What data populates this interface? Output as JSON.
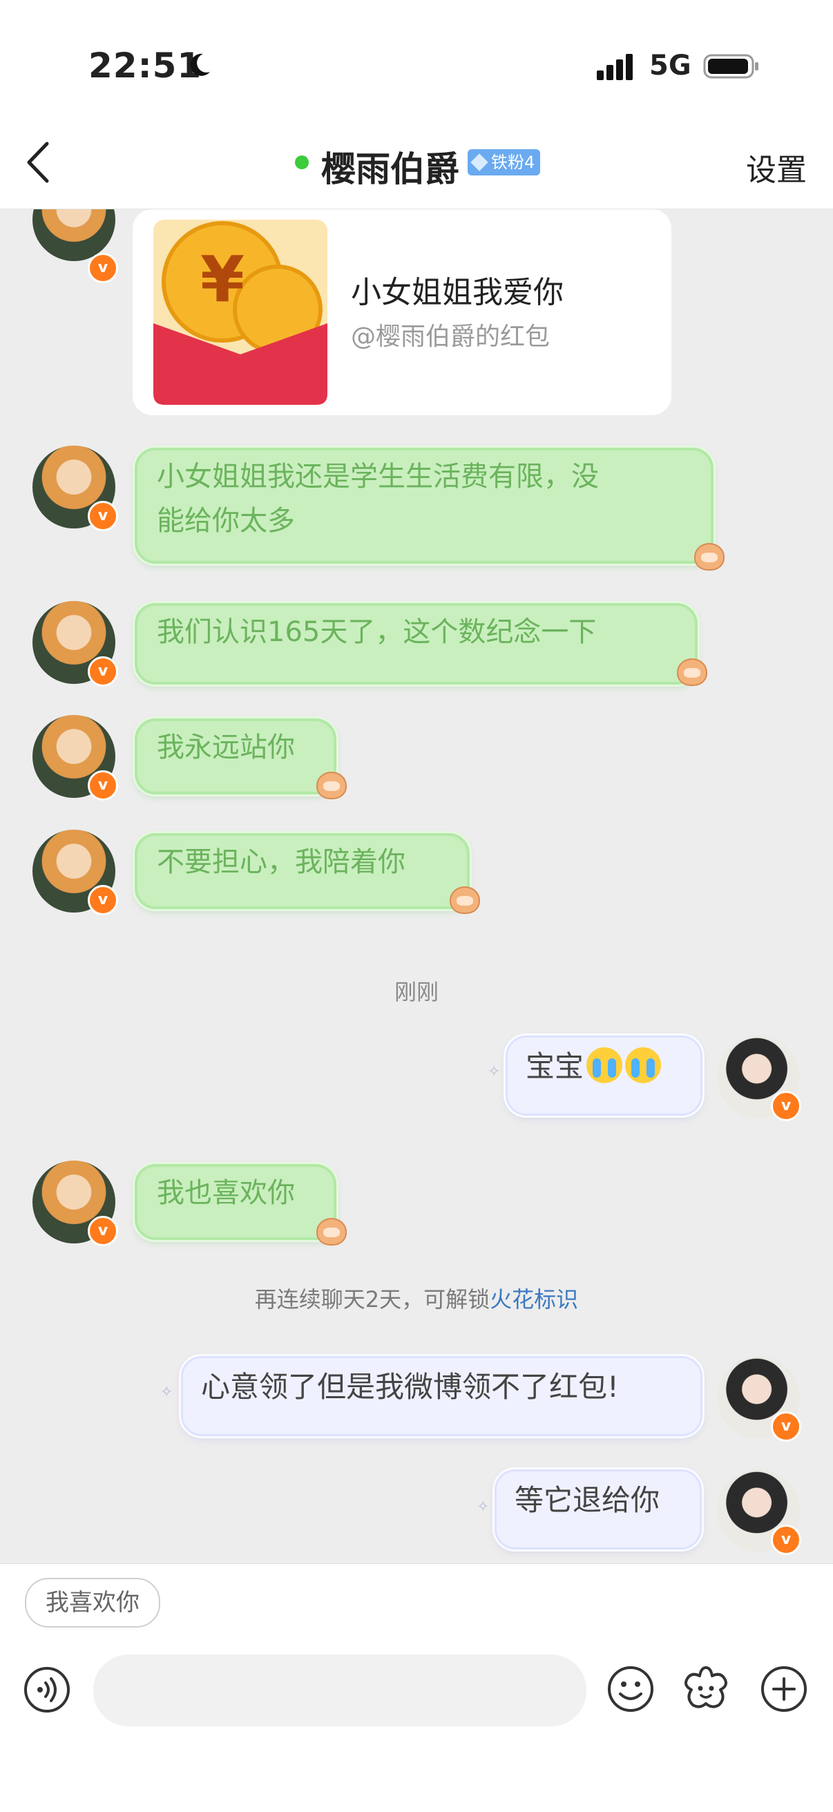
{
  "status_bar": {
    "time": "22:51",
    "network": "5G"
  },
  "header": {
    "title": "樱雨伯爵",
    "badge": "铁粉4",
    "settings": "设置"
  },
  "messages": {
    "red_packet": {
      "title": "小女姐姐我爱你",
      "subtitle": "@樱雨伯爵的红包"
    },
    "m1_line1": "小女姐姐我还是学生生活费有限，没",
    "m1_line2": "能给你太多",
    "m2": "我们认识165天了，这个数纪念一下",
    "m3": "我永远站你",
    "m4": "不要担心，我陪着你",
    "timestamp": "刚刚",
    "me1": "宝宝",
    "m5": "我也喜欢你",
    "hint_prefix": "再连续聊天2天，可解锁",
    "hint_link": "火花标识",
    "me2": "心意领了但是我微博领不了红包!",
    "me3": "等它退给你"
  },
  "input_area": {
    "quick_reply": "我喜欢你",
    "input_placeholder": ""
  },
  "icons": {
    "back": "chevron-left-icon",
    "voice": "voice-icon",
    "emoji": "emoji-icon",
    "sticker": "sticker-icon",
    "add": "plus-icon",
    "verified": "v"
  },
  "colors": {
    "accent_green": "#3ccc3c",
    "bubble_green": "#c9efbe",
    "bubble_green_text": "#6bb35d",
    "bubble_me": "#eff1ff",
    "verified_orange": "#ff7a1a",
    "link_blue": "#3b79c2"
  }
}
